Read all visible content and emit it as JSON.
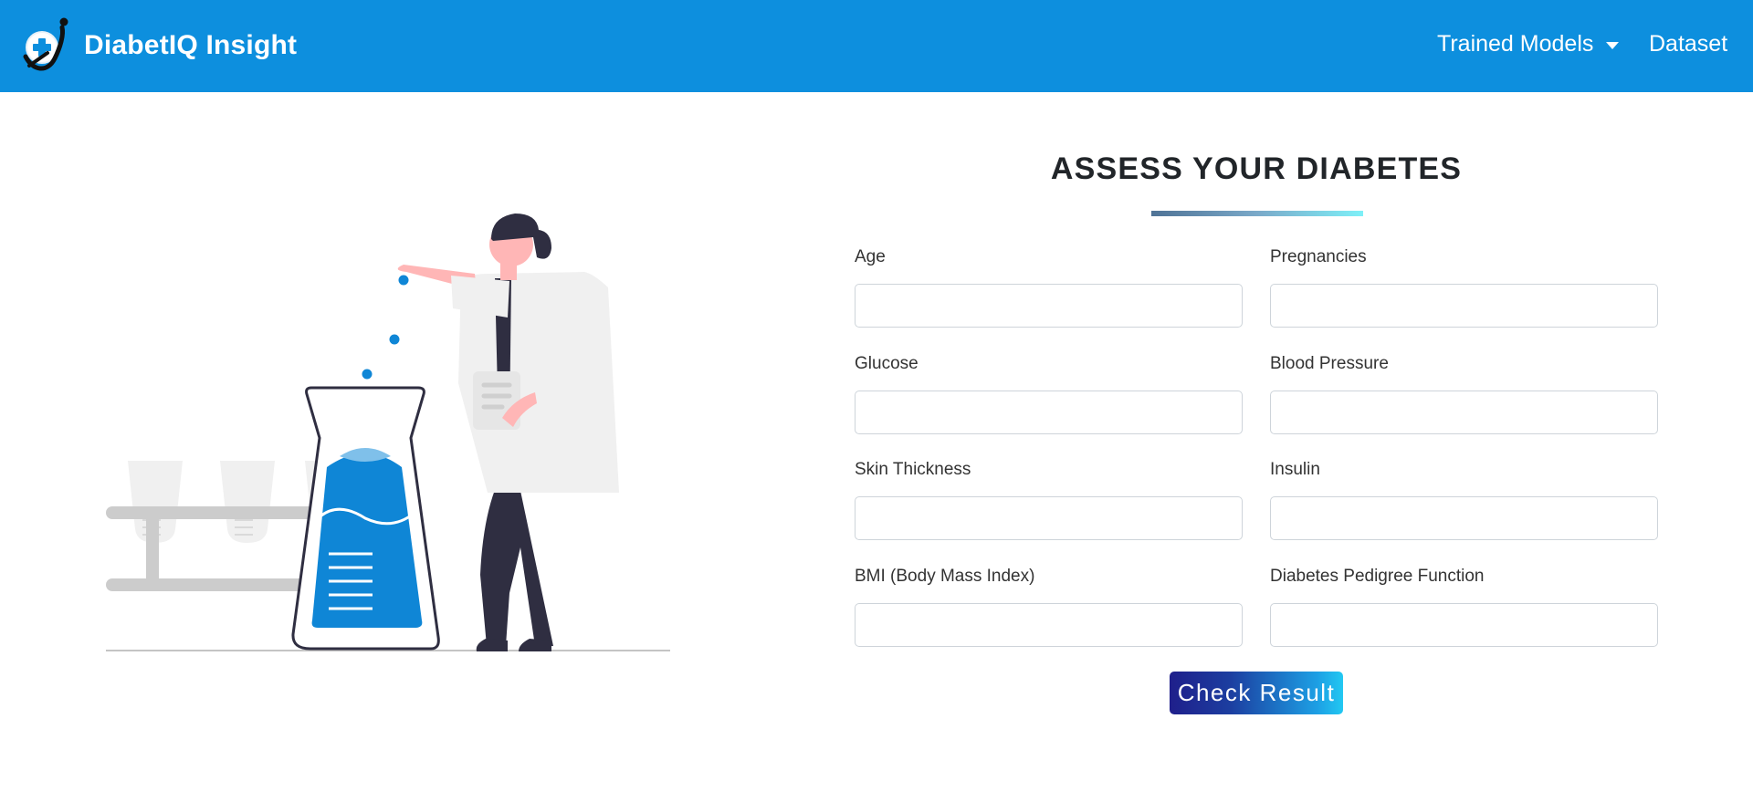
{
  "navbar": {
    "brand": "DiabetIQ Insight",
    "logo_icon": "diabetes-medical-logo",
    "menu": {
      "trained_models": "Trained Models",
      "dataset": "Dataset"
    }
  },
  "colors": {
    "navbar": "#0d8fde",
    "accent_blue": "#0f86d6",
    "button_gradient_start": "#1f1f8b",
    "button_gradient_end": "#22c8f2"
  },
  "form": {
    "title": "ASSESS YOUR DIABETES",
    "fields": {
      "age": "Age",
      "pregnancies": "Pregnancies",
      "glucose": "Glucose",
      "blood_pressure": "Blood Pressure",
      "skin_thickness": "Skin Thickness",
      "insulin": "Insulin",
      "bmi": "BMI (Body Mass Index)",
      "dpf": "Diabetes Pedigree Function"
    },
    "submit": "Check Result"
  }
}
